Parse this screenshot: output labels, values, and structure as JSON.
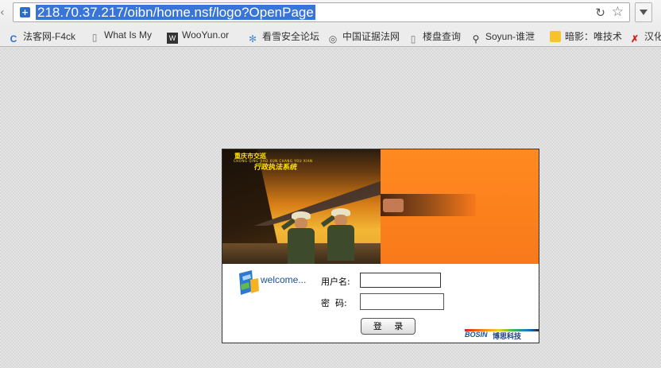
{
  "browser": {
    "url": "218.70.37.217/oibn/home.nsf/logo?OpenPage",
    "bookmarks": [
      {
        "label": "法客网-F4ck",
        "icon": "blue-c-icon"
      },
      {
        "label": "What Is My",
        "icon": "page-icon"
      },
      {
        "label": "WooYun.or",
        "icon": "wooyun-icon"
      },
      {
        "label": "看雪安全论坛",
        "icon": "snowflake-icon"
      },
      {
        "label": "中国证据法网",
        "icon": "evidence-icon"
      },
      {
        "label": "楼盘查询",
        "icon": "page-icon"
      },
      {
        "label": "Soyun-谁泄",
        "icon": "search-icon"
      },
      {
        "label": "暗影：唯技术",
        "icon": "folder-icon"
      },
      {
        "label": "汉化",
        "icon": "red-x-icon"
      }
    ]
  },
  "login": {
    "banner_title": "重庆市交巡",
    "banner_caption": "CHONG QING JIAO XUN CHANG YOU XIAN",
    "banner_slogan": "行政执法系统",
    "welcome": "welcome...",
    "username_label": "用户名:",
    "password_label": "密  码:",
    "username_value": "",
    "password_value": "",
    "submit_label": "登 录",
    "company_logo": "BOSIN",
    "company_name": "博思科技"
  }
}
